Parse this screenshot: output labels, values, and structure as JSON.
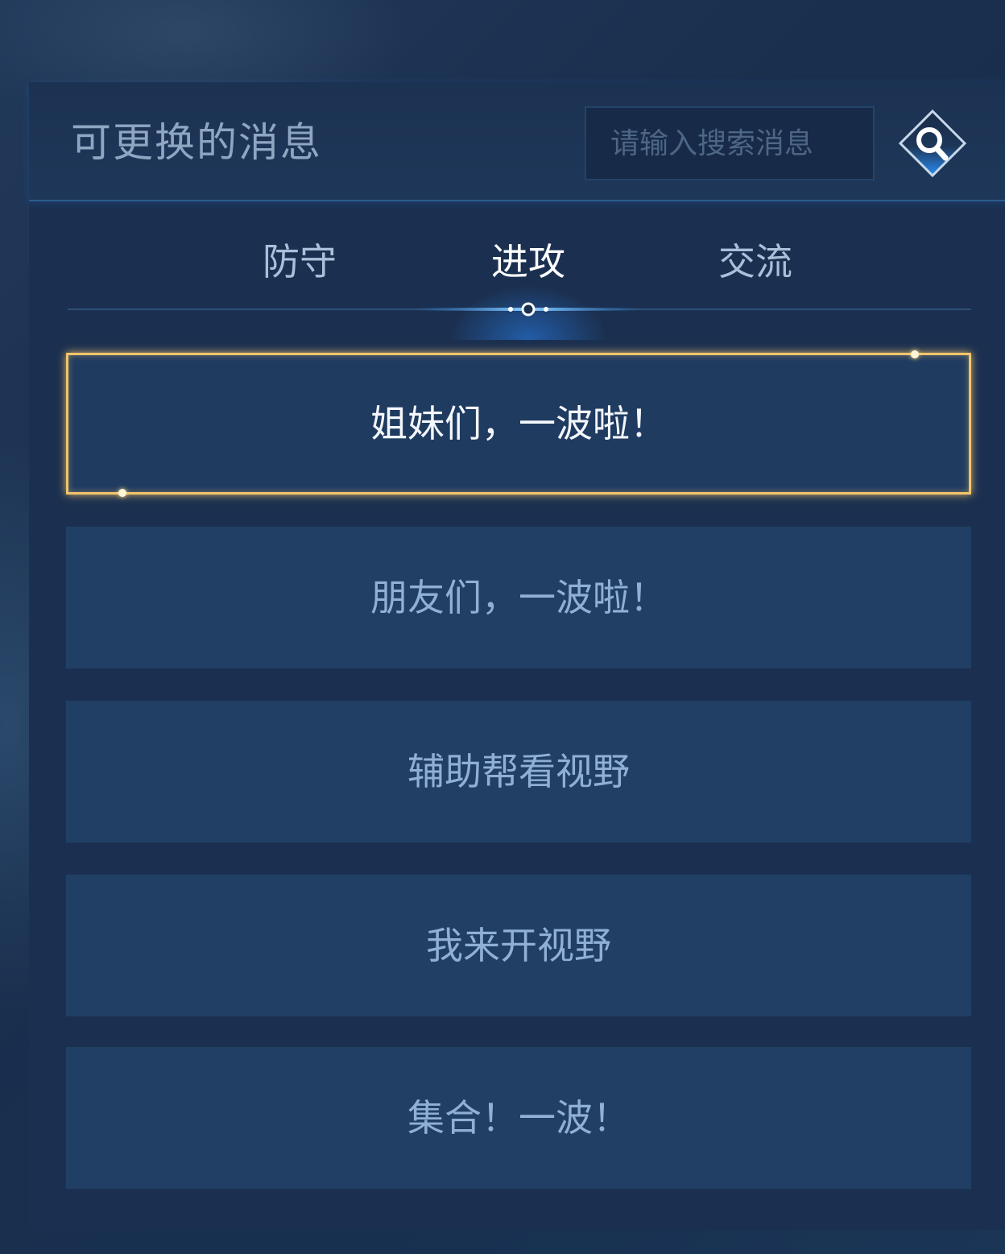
{
  "panel": {
    "title": "可更换的消息"
  },
  "search": {
    "placeholder": "请输入搜索消息",
    "icon": "search-icon"
  },
  "tabs": [
    {
      "label": "防守",
      "active": false
    },
    {
      "label": "进攻",
      "active": true
    },
    {
      "label": "交流",
      "active": false
    }
  ],
  "messages": [
    {
      "text": "姐妹们，一波啦！",
      "selected": true
    },
    {
      "text": "朋友们，一波啦！",
      "selected": false
    },
    {
      "text": "辅助帮看视野",
      "selected": false
    },
    {
      "text": "我来开视野",
      "selected": false
    },
    {
      "text": "集合！一波！",
      "selected": false
    }
  ],
  "colors": {
    "panel_bg": "#1b3050",
    "item_bg": "#213f65",
    "selected_border": "#f2c46a",
    "tab_active": "#ffffff",
    "tab_inactive": "#a9c0da",
    "accent_blue": "#2a8cf0"
  }
}
